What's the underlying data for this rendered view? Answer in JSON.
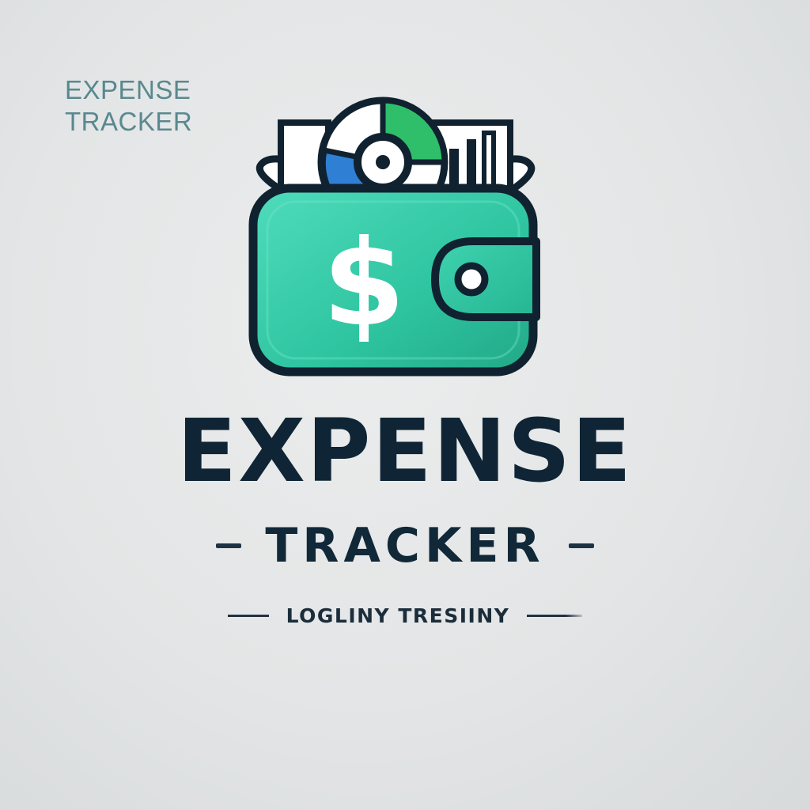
{
  "corner_label": {
    "line1": "EXPENSE",
    "line2": "TRACKER"
  },
  "logo": {
    "icon": "wallet-icon",
    "badge_icon": "dollar-icon",
    "chart_icon": "pie-chart-icon",
    "bars_icon": "bar-chart-icon",
    "dollar_symbol": "$",
    "colors": {
      "wallet": "#2ec4a0",
      "wallet_light": "#4fdcbc",
      "outline": "#10222f",
      "chart_blue": "#2f7fd4",
      "chart_green": "#2fbf6a",
      "paper": "#ffffff"
    }
  },
  "title": {
    "main": "EXPENSE",
    "sub": "TRACKER"
  },
  "tagline": "LOGLINY TRESIINY",
  "colors": {
    "text_dark": "#0f2535",
    "corner_text": "#4a7f86",
    "background": "#e3e5e6"
  }
}
